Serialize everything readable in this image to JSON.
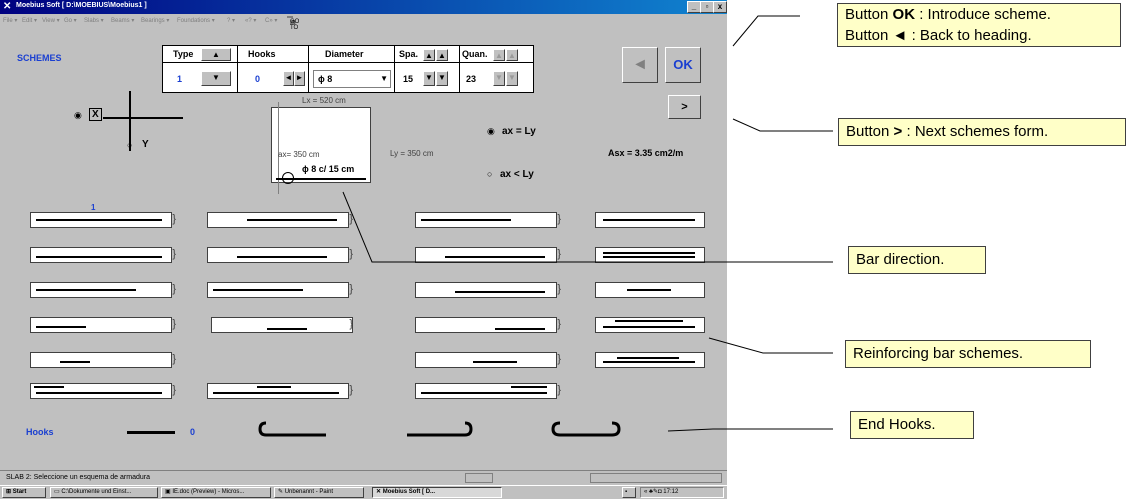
{
  "window": {
    "app_icon": "moebius-x-icon",
    "title": "Moebius Soft     [ D:\\MOEBIUS\\Moebius1 ]",
    "controls": [
      "_",
      "ɐ",
      "x"
    ]
  },
  "menubar": {
    "items": [
      "File ▾",
      "Edit ▾",
      "View ▾",
      "Go ▾",
      "Slabs ▾",
      "Beams ▾",
      "Bearings ▾",
      "Foundations ▾",
      "? ▾",
      "«? ▾",
      "C» ▾"
    ],
    "job_form": "GO TO THE JOB FORM"
  },
  "schemes_label": "SCHEMES",
  "params": {
    "type_label": "Type",
    "type_value": "1",
    "hooks_label": "Hooks",
    "hooks_value": "0",
    "diameter_label": "Diameter",
    "diameter_value": "ϕ 8",
    "spa_label": "Spa.",
    "spa_value": "15",
    "quan_label": "Quan.",
    "quan_value": "23"
  },
  "buttons": {
    "back": "◄",
    "ok": "OK",
    "next": ">"
  },
  "axes": {
    "x": "X",
    "y": "Y"
  },
  "slab": {
    "lx": "Lx = 520 cm",
    "ax": "ax= 350 cm",
    "bar": "ϕ 8 c/ 15 cm",
    "ly": "Ly = 350 cm"
  },
  "options": {
    "eq": "ax = Ly",
    "lt": "ax < Ly"
  },
  "asx": "Asx =  3.35   cm2/m",
  "scheme_number": "1",
  "hooks_row": {
    "label": "Hooks",
    "value": "0"
  },
  "status": "SLAB 2: Seleccione un esquema de armadura",
  "taskbar": {
    "start": "Start",
    "items": [
      "C:\\Dokumente und Einst...",
      "IE.doc (Preview) - Micros...",
      "Unbenannt - Paint",
      "Moebius Soft     [ D..."
    ],
    "clock": "17:12"
  },
  "callouts": {
    "ok_line1_prefix": "Button ",
    "ok_line1_key": "OK",
    "ok_line1_rest": " : Introduce scheme.",
    "ok_line2_prefix": "Button   ",
    "ok_line2_key": "◄",
    "ok_line2_rest": "  : Back to heading.",
    "next_prefix": "Button  ",
    "next_key": ">",
    "next_rest": " : Next schemes form.",
    "bar_direction": "Bar direction.",
    "schemes": "Reinforcing bar schemes.",
    "hooks": "End Hooks."
  }
}
